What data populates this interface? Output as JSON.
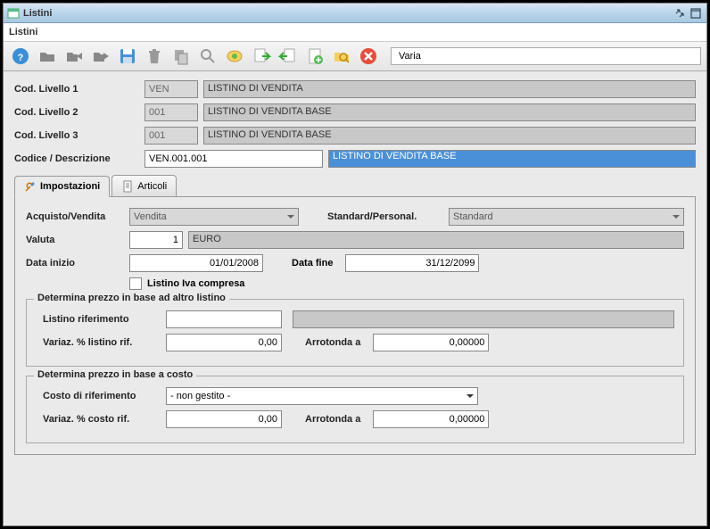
{
  "window": {
    "title": "Listini",
    "subtitle": "Listini"
  },
  "toolbar": {
    "status": "Varia"
  },
  "level1": {
    "label": "Cod. Livello 1",
    "code": "VEN",
    "desc": "LISTINO DI VENDITA"
  },
  "level2": {
    "label": "Cod. Livello 2",
    "code": "001",
    "desc": "LISTINO DI VENDITA BASE"
  },
  "level3": {
    "label": "Cod. Livello 3",
    "code": "001",
    "desc": "LISTINO DI VENDITA BASE"
  },
  "codedesc": {
    "label": "Codice / Descrizione",
    "code": "VEN.001.001",
    "desc": "LISTINO DI VENDITA BASE"
  },
  "tabs": {
    "impostazioni": "Impostazioni",
    "articoli": "Articoli"
  },
  "form": {
    "acqven_label": "Acquisto/Vendita",
    "acqven_value": "Vendita",
    "stdpers_label": "Standard/Personal.",
    "stdpers_value": "Standard",
    "valuta_label": "Valuta",
    "valuta_value": "1",
    "valuta_desc": "EURO",
    "datainizio_label": "Data inizio",
    "datainizio_value": "01/01/2008",
    "datafine_label": "Data fine",
    "datafine_value": "31/12/2099",
    "iva_label": "Listino Iva compresa"
  },
  "group1": {
    "title": "Determina prezzo in base ad altro listino",
    "listino_label": "Listino riferimento",
    "listino_value": "",
    "variaz_label": "Variaz. % listino rif.",
    "variaz_value": "0,00",
    "arrot_label": "Arrotonda a",
    "arrot_value": "0,00000"
  },
  "group2": {
    "title": "Determina prezzo in base a costo",
    "costo_label": "Costo di riferimento",
    "costo_value": "- non gestito -",
    "variaz_label": "Variaz. % costo rif.",
    "variaz_value": "0,00",
    "arrot_label": "Arrotonda a",
    "arrot_value": "0,00000"
  }
}
